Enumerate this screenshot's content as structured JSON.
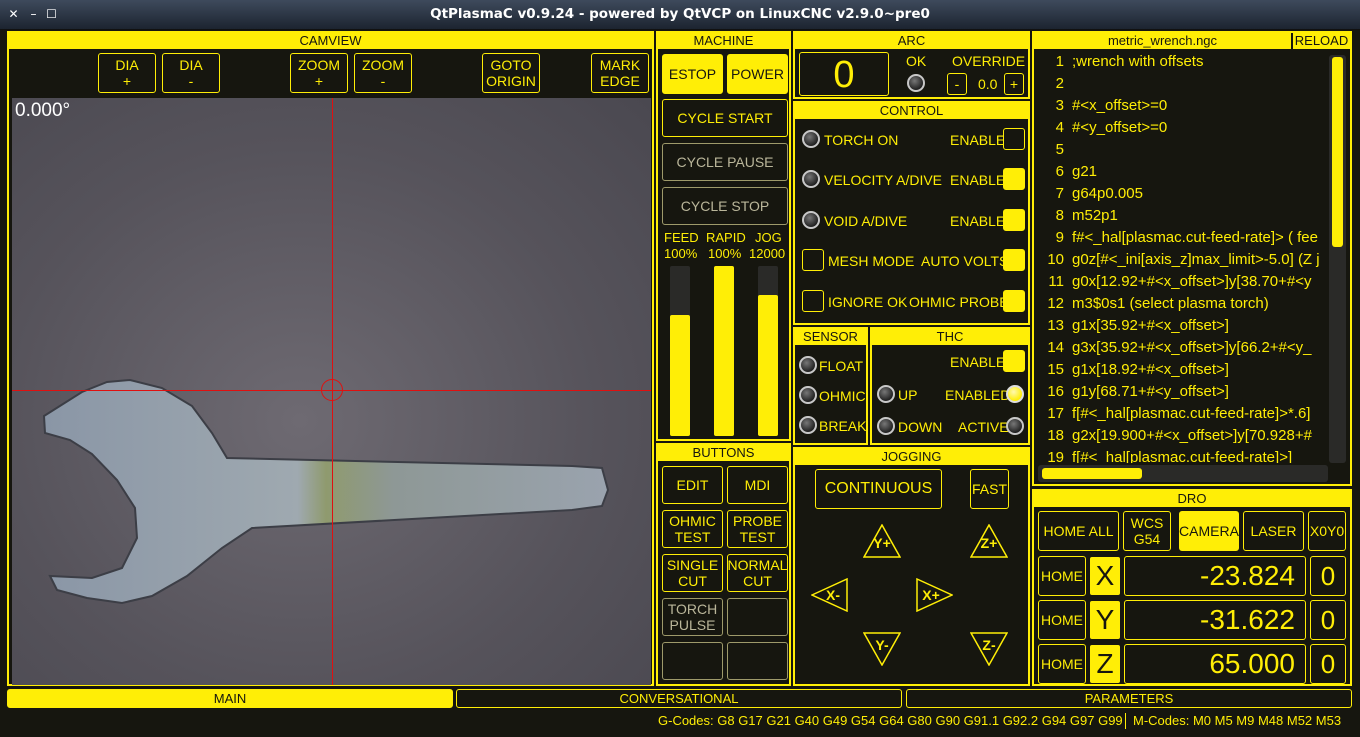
{
  "window": {
    "title": "QtPlasmaC v0.9.24 - powered by QtVCP on LinuxCNC v2.9.0~pre0"
  },
  "camview": {
    "title": "CAMVIEW",
    "buttons": [
      "DIA\n+",
      "DIA\n-",
      "ZOOM\n+",
      "ZOOM\n-",
      "GOTO\nORIGIN",
      "MARK\nEDGE"
    ],
    "angle": "0.000°"
  },
  "machine": {
    "title": "MACHINE",
    "estop": "ESTOP",
    "power": "POWER",
    "cycle_start": "CYCLE START",
    "cycle_pause": "CYCLE PAUSE",
    "cycle_stop": "CYCLE STOP",
    "feed_label": "FEED",
    "feed_value": "100%",
    "rapid_label": "RAPID",
    "rapid_value": "100%",
    "jog_label": "JOG",
    "jog_value": "12000",
    "feed_level": 0.71,
    "rapid_level": 1.0,
    "jog_level": 0.83
  },
  "buttons_panel": {
    "title": "BUTTONS",
    "items": [
      "EDIT",
      "MDI",
      "OHMIC\nTEST",
      "PROBE\nTEST",
      "SINGLE\nCUT",
      "NORMAL\nCUT",
      "TORCH\nPULSE",
      "",
      "",
      ""
    ]
  },
  "arc": {
    "title": "ARC",
    "value": "0",
    "ok_label": "OK",
    "override_label": "OVERRIDE",
    "override_value": "0.0",
    "minus": "-",
    "plus": "+"
  },
  "control": {
    "title": "CONTROL",
    "torch_on": "TORCH ON",
    "velocity": "VELOCITY A/DIVE",
    "void": "VOID A/DIVE",
    "enable": "ENABLE",
    "mesh_mode": "MESH MODE",
    "auto_volts": "AUTO VOLTS",
    "ignore_ok": "IGNORE OK",
    "ohmic_probe": "OHMIC PROBE"
  },
  "sensor": {
    "title": "SENSOR",
    "float": "FLOAT",
    "ohmic": "OHMIC",
    "break": "BREAK"
  },
  "thc": {
    "title": "THC",
    "enable": "ENABLE",
    "up": "UP",
    "enabled": "ENABLED",
    "down": "DOWN",
    "active": "ACTIVE"
  },
  "jogging": {
    "title": "JOGGING",
    "continuous": "CONTINUOUS",
    "fast": "FAST",
    "y_plus": "Y+",
    "z_plus": "Z+",
    "x_minus": "X-",
    "x_plus": "X+",
    "y_minus": "Y-",
    "z_minus": "Z-"
  },
  "gcode": {
    "filename": "metric_wrench.ngc",
    "reload": "RELOAD",
    "lines": [
      {
        "n": "1",
        "text": ";wrench with offsets"
      },
      {
        "n": "2",
        "text": ""
      },
      {
        "n": "3",
        "text": "#<x_offset>=0"
      },
      {
        "n": "4",
        "text": "#<y_offset>=0"
      },
      {
        "n": "5",
        "text": ""
      },
      {
        "n": "6",
        "text": "g21"
      },
      {
        "n": "7",
        "text": "g64p0.005"
      },
      {
        "n": "8",
        "text": "m52p1"
      },
      {
        "n": "9",
        "text": "f#<_hal[plasmac.cut-feed-rate]> ( fee"
      },
      {
        "n": "10",
        "text": "g0z[#<_ini[axis_z]max_limit>-5.0] (Z j"
      },
      {
        "n": "11",
        "text": "g0x[12.92+#<x_offset>]y[38.70+#<y"
      },
      {
        "n": "12",
        "text": "m3$0s1 (select plasma torch)"
      },
      {
        "n": "13",
        "text": "g1x[35.92+#<x_offset>]"
      },
      {
        "n": "14",
        "text": "g3x[35.92+#<x_offset>]y[66.2+#<y_"
      },
      {
        "n": "15",
        "text": "g1x[18.92+#<x_offset>]"
      },
      {
        "n": "16",
        "text": "g1y[68.71+#<y_offset>]"
      },
      {
        "n": "17",
        "text": "f[#<_hal[plasmac.cut-feed-rate]>*.6]"
      },
      {
        "n": "18",
        "text": "g2x[19.900+#<x_offset>]y[70.928+#"
      },
      {
        "n": "19",
        "text": "f[#<_hal[plasmac.cut-feed-rate]>]"
      }
    ]
  },
  "dro": {
    "title": "DRO",
    "home_all": "HOME ALL",
    "wcs": "WCS\nG54",
    "camera": "CAMERA",
    "laser": "LASER",
    "x0y0": "X0Y0",
    "home": "HOME",
    "axes": [
      {
        "name": "X",
        "value": "-23.824",
        "offset": "0"
      },
      {
        "name": "Y",
        "value": "-31.622",
        "offset": "0"
      },
      {
        "name": "Z",
        "value": "65.000",
        "offset": "0"
      }
    ]
  },
  "tabs": {
    "main": "MAIN",
    "conversational": "CONVERSATIONAL",
    "parameters": "PARAMETERS"
  },
  "status": {
    "gcodes": "G-Codes: G8 G17 G21 G40 G49 G54 G64 G80 G90 G91.1 G92.2 G94 G97 G99",
    "mcodes": "M-Codes: M0 M5 M9 M48 M52 M53"
  },
  "colors": {
    "accent": "#ffee06",
    "background": "#16160f"
  }
}
